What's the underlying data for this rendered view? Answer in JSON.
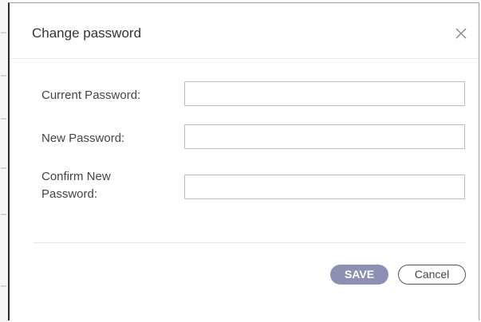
{
  "dialog": {
    "title": "Change password",
    "close_icon": "close-icon"
  },
  "form": {
    "fields": [
      {
        "label": "Current Password:",
        "value": "",
        "placeholder": ""
      },
      {
        "label": "New Password:",
        "value": "",
        "placeholder": ""
      },
      {
        "label": "Confirm New Password:",
        "value": "",
        "placeholder": ""
      }
    ]
  },
  "actions": {
    "save_label": "SAVE",
    "cancel_label": "Cancel"
  },
  "colors": {
    "save_button_bg": "#8d8fb3",
    "text": "#444444",
    "input_border": "#bdbdbd"
  }
}
